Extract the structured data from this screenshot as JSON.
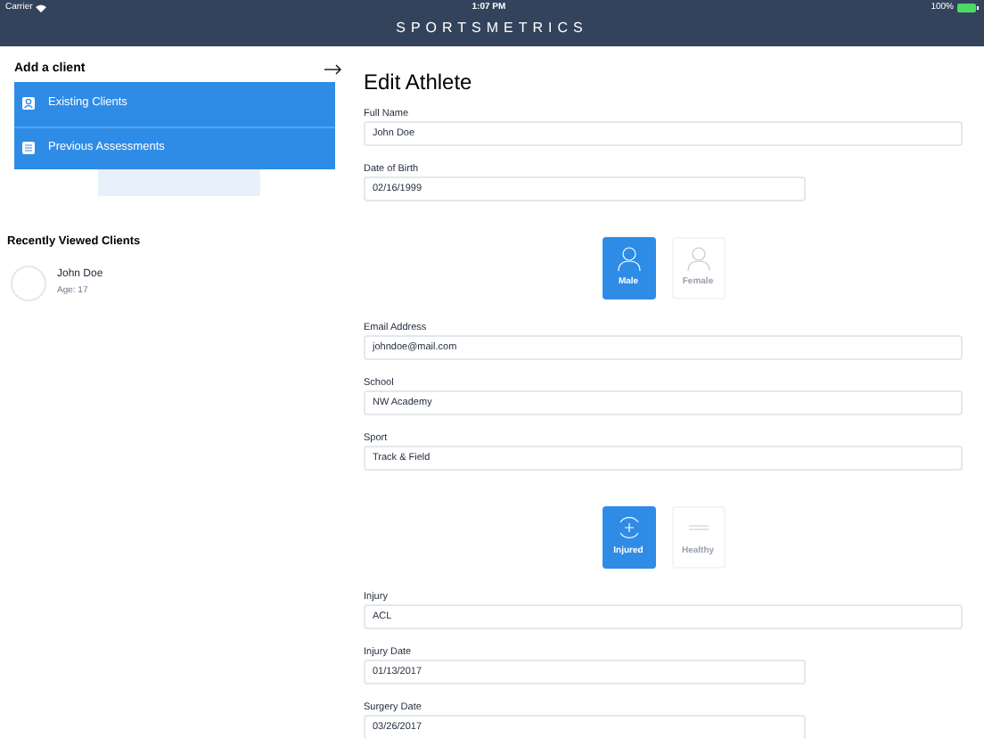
{
  "status_bar": {
    "carrier": "Carrier",
    "time": "1:07 PM",
    "battery": "100%"
  },
  "header": {
    "title": "SPORTSMETRICS"
  },
  "sidebar": {
    "title": "Add a client",
    "menu": [
      {
        "label": "Existing Clients",
        "kind": "person"
      },
      {
        "label": "Previous Assessments",
        "kind": "list"
      }
    ],
    "recent_title": "Recently Viewed Clients",
    "recent": [
      {
        "name": "John Doe",
        "detail": "Age: 17"
      }
    ]
  },
  "form": {
    "title": "Edit Athlete",
    "items": [
      {
        "kind": "text_field",
        "label": "Full Name",
        "value": "John Doe"
      },
      {
        "kind": "date_field",
        "label": "Date of Birth",
        "value": "02/16/1999"
      },
      {
        "kind": "gender_choice",
        "options": [
          {
            "label": "Male",
            "selected": true
          },
          {
            "label": "Female",
            "selected": false
          }
        ]
      },
      {
        "kind": "text_field",
        "label": "Email Address",
        "value": "johndoe@mail.com"
      },
      {
        "kind": "text_field",
        "label": "School",
        "value": "NW Academy"
      },
      {
        "kind": "text_field",
        "label": "Sport",
        "value": "Track & Field"
      },
      {
        "kind": "status_choice",
        "options": [
          {
            "label": "Injured",
            "selected": true
          },
          {
            "label": "Healthy",
            "selected": false
          }
        ]
      },
      {
        "kind": "text_field",
        "label": "Injury",
        "value": "ACL"
      },
      {
        "kind": "date_field",
        "label": "Injury Date",
        "value": "01/13/2017"
      },
      {
        "kind": "date_field",
        "label": "Surgery Date",
        "value": "03/26/2017"
      }
    ]
  }
}
